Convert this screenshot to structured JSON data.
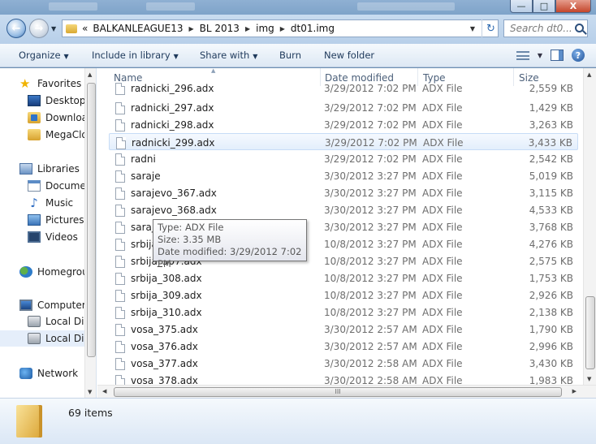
{
  "window": {
    "controls": [
      "—",
      "□",
      "X"
    ]
  },
  "address": {
    "overflow": "«",
    "crumbs": [
      "BALKANLEAGUE13",
      "BL 2013",
      "img",
      "dt01.img"
    ],
    "search_placeholder": "Search dt0..."
  },
  "toolbar": {
    "organize": "Organize",
    "include": "Include in library",
    "share": "Share with",
    "burn": "Burn",
    "new_folder": "New folder"
  },
  "nav": {
    "favorites": "Favorites",
    "desktop": "Desktop",
    "downloads": "Downloa",
    "megacloud": "MegaClo",
    "libraries": "Libraries",
    "documents": "Documer",
    "music": "Music",
    "pictures": "Pictures",
    "videos": "Videos",
    "homegroup": "Homegrou",
    "computer": "Computer",
    "local1": "Local Dis",
    "local2": "Local Dis",
    "network": "Network"
  },
  "columns": {
    "name": "Name",
    "date": "Date modified",
    "type": "Type",
    "size": "Size"
  },
  "files": [
    {
      "name": "radnicki_296.adx",
      "date": "3/29/2012 7:02 PM",
      "type": "ADX File",
      "size": "2,559 KB"
    },
    {
      "name": "radnicki_297.adx",
      "date": "3/29/2012 7:02 PM",
      "type": "ADX File",
      "size": "1,429 KB"
    },
    {
      "name": "radnicki_298.adx",
      "date": "3/29/2012 7:02 PM",
      "type": "ADX File",
      "size": "3,263 KB"
    },
    {
      "name": "radnicki_299.adx",
      "date": "3/29/2012 7:02 PM",
      "type": "ADX File",
      "size": "3,433 KB"
    },
    {
      "name": "radni",
      "date": "3/29/2012 7:02 PM",
      "type": "ADX File",
      "size": "2,542 KB"
    },
    {
      "name": "saraje",
      "date": "3/30/2012 3:27 PM",
      "type": "ADX File",
      "size": "5,019 KB"
    },
    {
      "name": "sarajevo_367.adx",
      "date": "3/30/2012 3:27 PM",
      "type": "ADX File",
      "size": "3,115 KB"
    },
    {
      "name": "sarajevo_368.adx",
      "date": "3/30/2012 3:27 PM",
      "type": "ADX File",
      "size": "4,533 KB"
    },
    {
      "name": "sarajevo_369.adx",
      "date": "3/30/2012 3:27 PM",
      "type": "ADX File",
      "size": "3,768 KB"
    },
    {
      "name": "srbija_306.adx",
      "date": "10/8/2012 3:27 PM",
      "type": "ADX File",
      "size": "4,276 KB"
    },
    {
      "name": "srbija_307.adx",
      "date": "10/8/2012 3:27 PM",
      "type": "ADX File",
      "size": "2,575 KB"
    },
    {
      "name": "srbija_308.adx",
      "date": "10/8/2012 3:27 PM",
      "type": "ADX File",
      "size": "1,753 KB"
    },
    {
      "name": "srbija_309.adx",
      "date": "10/8/2012 3:27 PM",
      "type": "ADX File",
      "size": "2,926 KB"
    },
    {
      "name": "srbija_310.adx",
      "date": "10/8/2012 3:27 PM",
      "type": "ADX File",
      "size": "2,138 KB"
    },
    {
      "name": "vosa_375.adx",
      "date": "3/30/2012 2:57 AM",
      "type": "ADX File",
      "size": "1,790 KB"
    },
    {
      "name": "vosa_376.adx",
      "date": "3/30/2012 2:57 AM",
      "type": "ADX File",
      "size": "2,996 KB"
    },
    {
      "name": "vosa_377.adx",
      "date": "3/30/2012 2:58 AM",
      "type": "ADX File",
      "size": "3,430 KB"
    },
    {
      "name": "vosa_378.adx",
      "date": "3/30/2012 2:58 AM",
      "type": "ADX File",
      "size": "1,983 KB"
    }
  ],
  "tooltip": {
    "type": "Type: ADX File",
    "size": "Size: 3.35 MB",
    "modified": "Date modified: 3/29/2012 7:02 PM"
  },
  "hscroll_label": "III",
  "details": {
    "count": "69 items"
  },
  "colors": {
    "accent": "#1e395b",
    "hover_row": "#e3eefc"
  }
}
